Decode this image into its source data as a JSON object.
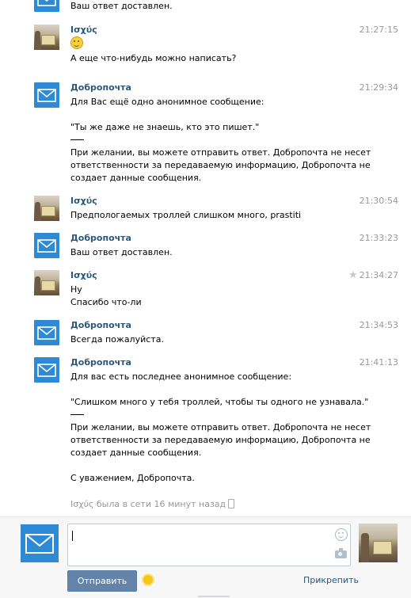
{
  "messages": [
    {
      "sender": "",
      "time": "",
      "avatar": "mail",
      "lines": [
        "Ваш ответ доставлен."
      ]
    },
    {
      "sender": "Ισχύς",
      "time": "21:27:15",
      "avatar": "photo",
      "lines": [
        "А еще что-нибудь можно написать?"
      ]
    },
    {
      "sender": "Добропочта",
      "time": "21:29:34",
      "avatar": "mail",
      "lines": [
        "Для Вас ещё одно анонимное сообщение:",
        "\"Ты же даже не знаешь, кто это пишет.\"",
        "При желании, вы можете отправить ответ. Добропочта не несет",
        "ответственности за передаваемую информацию, Добропочта не",
        "создает данные сообщения."
      ]
    },
    {
      "sender": "Ισχύς",
      "time": "21:30:54",
      "avatar": "photo",
      "lines": [
        "Предпологаемых троллей слишком много, prastiti"
      ]
    },
    {
      "sender": "Добропочта",
      "time": "21:33:23",
      "avatar": "mail",
      "lines": [
        "Ваш ответ доставлен."
      ]
    },
    {
      "sender": "Ισχύς",
      "time": "21:34:27",
      "avatar": "photo",
      "lines": [
        "Ну",
        "Спасибо что-ли"
      ]
    },
    {
      "sender": "Добропочта",
      "time": "21:34:53",
      "avatar": "mail",
      "lines": [
        "Всегда пожалуйста."
      ]
    },
    {
      "sender": "Добропочта",
      "time": "21:41:13",
      "avatar": "mail",
      "lines": [
        "Для вас есть последнее анонимное сообщение:",
        "\"Слишком много у тебя троллей, чтобы ты одного не узнавала.\"",
        "При желании, вы можете отправить ответ. Добропочта не несет",
        "ответственности за передаваемую информацию, Добропочта не",
        "создает данные сообщения.",
        "С уважением, Добропочта."
      ]
    }
  ],
  "status": "Ισχύς была в сети 16 минут назад",
  "composer": {
    "send_label": "Отправить",
    "attach_label": "Прикрепить"
  },
  "colors": {
    "name": "#2b587a",
    "time": "#999999",
    "send_button": "#6383a8",
    "mail_avatar": "#2f8ad6"
  },
  "icons": [
    "mail-avatar-icon",
    "smiley-emoji-icon",
    "star-icon",
    "smile-picker-icon",
    "camera-icon",
    "sun-icon",
    "phone-icon"
  ]
}
